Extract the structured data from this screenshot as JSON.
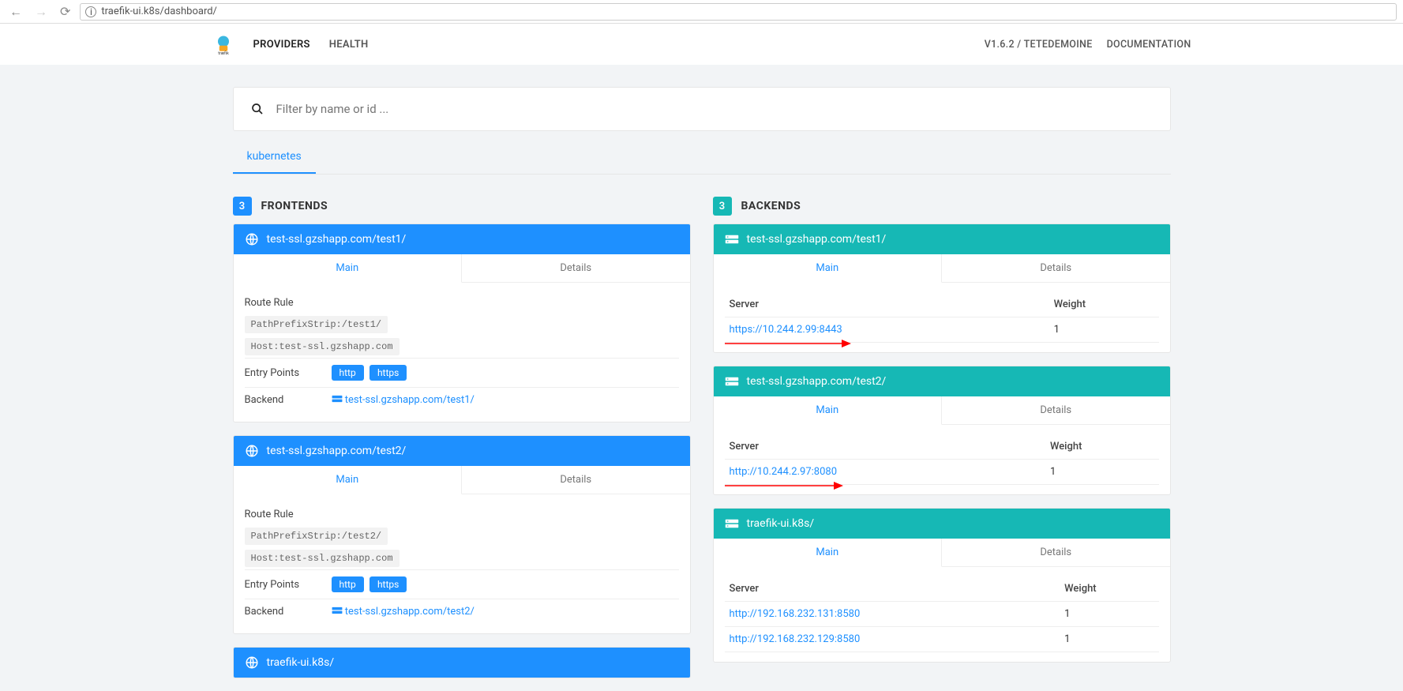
{
  "browser": {
    "url": "traefik-ui.k8s/dashboard/"
  },
  "nav": {
    "providers": "PROVIDERS",
    "health": "HEALTH",
    "version": "V1.6.2 / TETEDEMOINE",
    "docs": "DOCUMENTATION"
  },
  "search": {
    "placeholder": "Filter by name or id ..."
  },
  "providerTab": "kubernetes",
  "frontends": {
    "count": "3",
    "title": "FRONTENDS",
    "tabs": {
      "main": "Main",
      "details": "Details"
    },
    "labels": {
      "routeRule": "Route Rule",
      "entryPoints": "Entry Points",
      "backend": "Backend"
    },
    "items": [
      {
        "title": "test-ssl.gzshapp.com/test1/",
        "rules": [
          "PathPrefixStrip:/test1/",
          "Host:test-ssl.gzshapp.com"
        ],
        "entryPoints": [
          "http",
          "https"
        ],
        "backend": "test-ssl.gzshapp.com/test1/"
      },
      {
        "title": "test-ssl.gzshapp.com/test2/",
        "rules": [
          "PathPrefixStrip:/test2/",
          "Host:test-ssl.gzshapp.com"
        ],
        "entryPoints": [
          "http",
          "https"
        ],
        "backend": "test-ssl.gzshapp.com/test2/"
      },
      {
        "title": "traefik-ui.k8s/"
      }
    ]
  },
  "backends": {
    "count": "3",
    "title": "BACKENDS",
    "tabs": {
      "main": "Main",
      "details": "Details"
    },
    "cols": {
      "server": "Server",
      "weight": "Weight"
    },
    "items": [
      {
        "title": "test-ssl.gzshapp.com/test1/",
        "servers": [
          {
            "url": "https://10.244.2.99:8443",
            "weight": "1"
          }
        ],
        "arrow": true
      },
      {
        "title": "test-ssl.gzshapp.com/test2/",
        "servers": [
          {
            "url": "http://10.244.2.97:8080",
            "weight": "1"
          }
        ],
        "arrow": true
      },
      {
        "title": "traefik-ui.k8s/",
        "servers": [
          {
            "url": "http://192.168.232.131:8580",
            "weight": "1"
          },
          {
            "url": "http://192.168.232.129:8580",
            "weight": "1"
          }
        ]
      }
    ]
  }
}
